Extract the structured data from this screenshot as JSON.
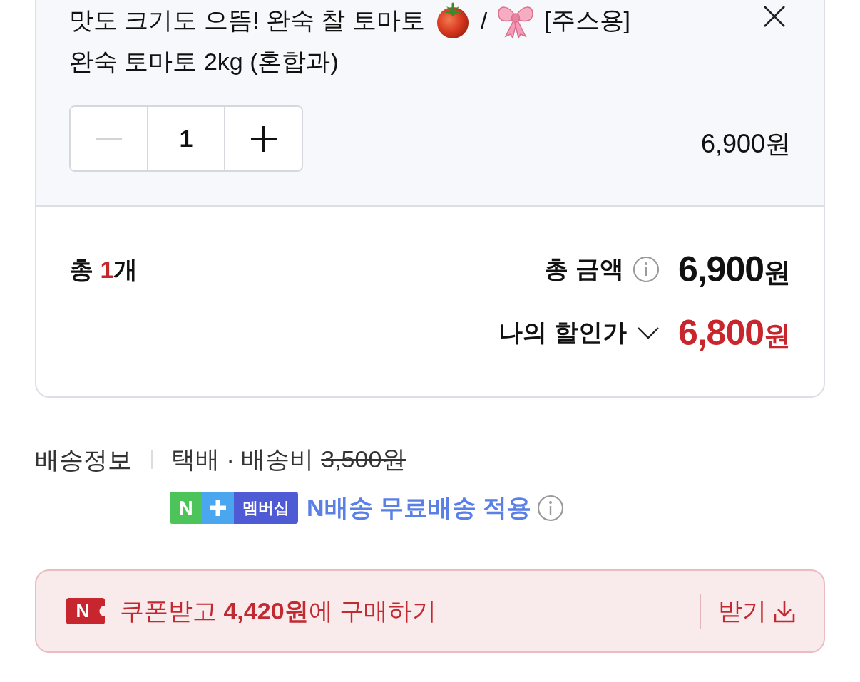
{
  "product": {
    "title": {
      "line_1": [
        "맛도 크기도 으뜸! 완숙 찰 토마토",
        "/",
        "[주스용]"
      ],
      "line_2": "완숙 토마토 2kg (혼합과)"
    },
    "quantity": {
      "value": "1",
      "decrease": {
        "disabled": true
      },
      "increase": {
        "disabled": false
      }
    },
    "price": "6,900원"
  },
  "summary": {
    "count": {
      "label": "총",
      "value": "1",
      "unit": "개"
    },
    "total": {
      "label": "총 금액",
      "amount": "6,900",
      "unit": "원"
    },
    "my_price": {
      "label": "나의 할인가",
      "expanded": false,
      "amount": "6,800",
      "unit": "원"
    }
  },
  "shipping": {
    "label": "배송정보",
    "method": "택배 · 배송비",
    "original_fee": "3,500원",
    "membership_badge": {
      "letter": "N",
      "name": "멤버십"
    },
    "benefit": "N배송 무료배송 적용"
  },
  "coupon": {
    "badge": "N",
    "text": "쿠폰받고 **4,420원**에 구매하기",
    "action": "받기"
  }
}
